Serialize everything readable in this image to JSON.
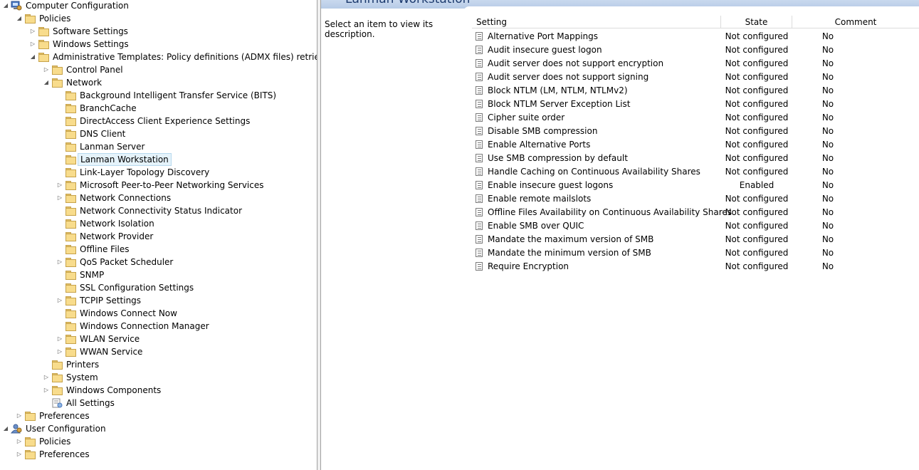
{
  "tree": [
    {
      "name": "tree-computer-configuration",
      "label": "Computer Configuration",
      "icon": "computer-config-icon",
      "expander": "expanded"
    },
    {
      "name": "tree-policies",
      "label": "Policies",
      "icon": "folder-icon",
      "expander": "expanded"
    },
    {
      "name": "tree-software-settings",
      "label": "Software Settings",
      "icon": "folder-icon",
      "expander": "collapsed"
    },
    {
      "name": "tree-windows-settings",
      "label": "Windows Settings",
      "icon": "folder-icon",
      "expander": "collapsed"
    },
    {
      "name": "tree-administrative-templates",
      "label": "Administrative Templates: Policy definitions (ADMX files) retrieved from",
      "icon": "folder-icon",
      "expander": "expanded"
    },
    {
      "name": "tree-control-panel",
      "label": "Control Panel",
      "icon": "folder-icon",
      "expander": "collapsed"
    },
    {
      "name": "tree-network",
      "label": "Network",
      "icon": "folder-icon",
      "expander": "expanded"
    },
    {
      "name": "tree-bits",
      "label": "Background Intelligent Transfer Service (BITS)",
      "icon": "folder-icon",
      "expander": "none"
    },
    {
      "name": "tree-branchcache",
      "label": "BranchCache",
      "icon": "folder-icon",
      "expander": "none"
    },
    {
      "name": "tree-directaccess",
      "label": "DirectAccess Client Experience Settings",
      "icon": "folder-icon",
      "expander": "none"
    },
    {
      "name": "tree-dns-client",
      "label": "DNS Client",
      "icon": "folder-icon",
      "expander": "none"
    },
    {
      "name": "tree-lanman-server",
      "label": "Lanman Server",
      "icon": "folder-icon",
      "expander": "none"
    },
    {
      "name": "tree-lanman-workstation",
      "label": "Lanman Workstation",
      "icon": "folder-icon",
      "expander": "none",
      "selected": true
    },
    {
      "name": "tree-link-layer",
      "label": "Link-Layer Topology Discovery",
      "icon": "folder-icon",
      "expander": "none"
    },
    {
      "name": "tree-p2p",
      "label": "Microsoft Peer-to-Peer Networking Services",
      "icon": "folder-icon",
      "expander": "collapsed"
    },
    {
      "name": "tree-network-connections",
      "label": "Network Connections",
      "icon": "folder-icon",
      "expander": "collapsed"
    },
    {
      "name": "tree-ncsi",
      "label": "Network Connectivity Status Indicator",
      "icon": "folder-icon",
      "expander": "none"
    },
    {
      "name": "tree-network-isolation",
      "label": "Network Isolation",
      "icon": "folder-icon",
      "expander": "none"
    },
    {
      "name": "tree-network-provider",
      "label": "Network Provider",
      "icon": "folder-icon",
      "expander": "none"
    },
    {
      "name": "tree-offline-files",
      "label": "Offline Files",
      "icon": "folder-icon",
      "expander": "none"
    },
    {
      "name": "tree-qos",
      "label": "QoS Packet Scheduler",
      "icon": "folder-icon",
      "expander": "collapsed"
    },
    {
      "name": "tree-snmp",
      "label": "SNMP",
      "icon": "folder-icon",
      "expander": "none"
    },
    {
      "name": "tree-ssl",
      "label": "SSL Configuration Settings",
      "icon": "folder-icon",
      "expander": "none"
    },
    {
      "name": "tree-tcpip",
      "label": "TCPIP Settings",
      "icon": "folder-icon",
      "expander": "collapsed"
    },
    {
      "name": "tree-wcn",
      "label": "Windows Connect Now",
      "icon": "folder-icon",
      "expander": "none"
    },
    {
      "name": "tree-wcm",
      "label": "Windows Connection Manager",
      "icon": "folder-icon",
      "expander": "none"
    },
    {
      "name": "tree-wlan",
      "label": "WLAN Service",
      "icon": "folder-icon",
      "expander": "collapsed"
    },
    {
      "name": "tree-wwan",
      "label": "WWAN Service",
      "icon": "folder-icon",
      "expander": "collapsed"
    },
    {
      "name": "tree-printers",
      "label": "Printers",
      "icon": "folder-icon",
      "expander": "none"
    },
    {
      "name": "tree-system",
      "label": "System",
      "icon": "folder-icon",
      "expander": "collapsed"
    },
    {
      "name": "tree-windows-components",
      "label": "Windows Components",
      "icon": "folder-icon",
      "expander": "collapsed"
    },
    {
      "name": "tree-all-settings",
      "label": "All Settings",
      "icon": "all-settings-icon",
      "expander": "none"
    },
    {
      "name": "tree-computer-preferences",
      "label": "Preferences",
      "icon": "folder-icon",
      "expander": "collapsed"
    },
    {
      "name": "tree-user-configuration",
      "label": "User Configuration",
      "icon": "user-config-icon",
      "expander": "expanded"
    },
    {
      "name": "tree-user-policies",
      "label": "Policies",
      "icon": "folder-icon",
      "expander": "collapsed"
    },
    {
      "name": "tree-user-preferences",
      "label": "Preferences",
      "icon": "folder-icon",
      "expander": "collapsed"
    }
  ],
  "right_pane": {
    "title": "Lanman Workstation",
    "description": "Select an item to view its description."
  },
  "table": {
    "columns": {
      "setting": "Setting",
      "state": "State",
      "comment": "Comment"
    },
    "rows": [
      {
        "setting": "Alternative Port Mappings",
        "state": "Not configured",
        "comment": "No"
      },
      {
        "setting": "Audit insecure guest logon",
        "state": "Not configured",
        "comment": "No"
      },
      {
        "setting": "Audit server does not support encryption",
        "state": "Not configured",
        "comment": "No"
      },
      {
        "setting": "Audit server does not support signing",
        "state": "Not configured",
        "comment": "No"
      },
      {
        "setting": "Block NTLM (LM, NTLM, NTLMv2)",
        "state": "Not configured",
        "comment": "No"
      },
      {
        "setting": "Block NTLM Server Exception List",
        "state": "Not configured",
        "comment": "No"
      },
      {
        "setting": "Cipher suite order",
        "state": "Not configured",
        "comment": "No"
      },
      {
        "setting": "Disable SMB compression",
        "state": "Not configured",
        "comment": "No"
      },
      {
        "setting": "Enable Alternative Ports",
        "state": "Not configured",
        "comment": "No"
      },
      {
        "setting": "Use SMB compression by default",
        "state": "Not configured",
        "comment": "No"
      },
      {
        "setting": "Handle Caching on Continuous Availability Shares",
        "state": "Not configured",
        "comment": "No"
      },
      {
        "setting": "Enable insecure guest logons",
        "state": "Enabled",
        "comment": "No"
      },
      {
        "setting": "Enable remote mailslots",
        "state": "Not configured",
        "comment": "No"
      },
      {
        "setting": "Offline Files Availability on Continuous Availability Shares",
        "state": "Not configured",
        "comment": "No"
      },
      {
        "setting": "Enable SMB over QUIC",
        "state": "Not configured",
        "comment": "No"
      },
      {
        "setting": "Mandate the maximum version of SMB",
        "state": "Not configured",
        "comment": "No"
      },
      {
        "setting": "Mandate the minimum version of SMB",
        "state": "Not configured",
        "comment": "No"
      },
      {
        "setting": "Require Encryption",
        "state": "Not configured",
        "comment": "No"
      }
    ]
  }
}
